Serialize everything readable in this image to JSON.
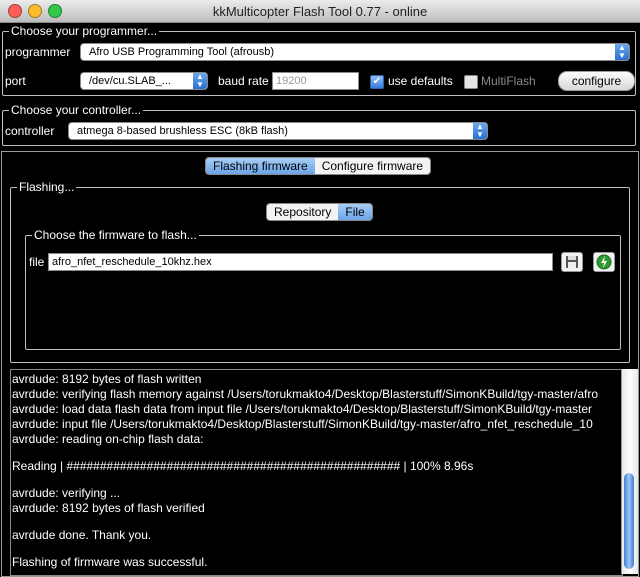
{
  "window": {
    "title": "kkMulticopter Flash Tool 0.77 - online",
    "traffic_colors": {
      "close": "#fc5f57",
      "minimize": "#fdbc2e",
      "zoom": "#34c84a"
    }
  },
  "programmer_section": {
    "title": "Choose your programmer...",
    "programmer_label": "programmer",
    "programmer_value": "Afro USB Programming Tool (afrousb)",
    "port_label": "port",
    "port_value": "/dev/cu.SLAB_...",
    "baud_label": "baud rate",
    "baud_value": "19200",
    "use_defaults_label": "use defaults",
    "use_defaults_checked": true,
    "multiflash_label": "MultiFlash",
    "multiflash_checked": false,
    "configure_label": "configure"
  },
  "controller_section": {
    "title": "Choose your controller...",
    "controller_label": "controller",
    "controller_value": "atmega 8-based brushless ESC (8kB flash)"
  },
  "tabs": {
    "flashing": "Flashing firmware",
    "configure": "Configure firmware",
    "active": "flashing"
  },
  "flashing_section": {
    "title": "Flashing...",
    "source_tabs": {
      "repository": "Repository",
      "file": "File",
      "active": "file"
    },
    "choose_title": "Choose the firmware to flash...",
    "file_label": "file",
    "file_value": "afro_nfet_reschedule_10khz.hex",
    "save_icon": "floppy-disk-icon",
    "flash_icon": "green-flash-icon"
  },
  "console": {
    "lines": [
      "avrdude: 8192 bytes of flash written",
      "avrdude: verifying flash memory against /Users/torukmakto4/Desktop/Blasterstuff/SimonKBuild/tgy-master/afro",
      "avrdude: load data flash data from input file /Users/torukmakto4/Desktop/Blasterstuff/SimonKBuild/tgy-master",
      "avrdude: input file /Users/torukmakto4/Desktop/Blasterstuff/SimonKBuild/tgy-master/afro_nfet_reschedule_10",
      "avrdude: reading on-chip flash data:",
      "",
      "Reading | ################################################## | 100% 8.96s",
      "",
      "avrdude: verifying ...",
      "avrdude: 8192 bytes of flash verified",
      "",
      "avrdude done.  Thank you.",
      "",
      "Flashing of firmware was successful."
    ],
    "scroll_position": 0.95
  }
}
